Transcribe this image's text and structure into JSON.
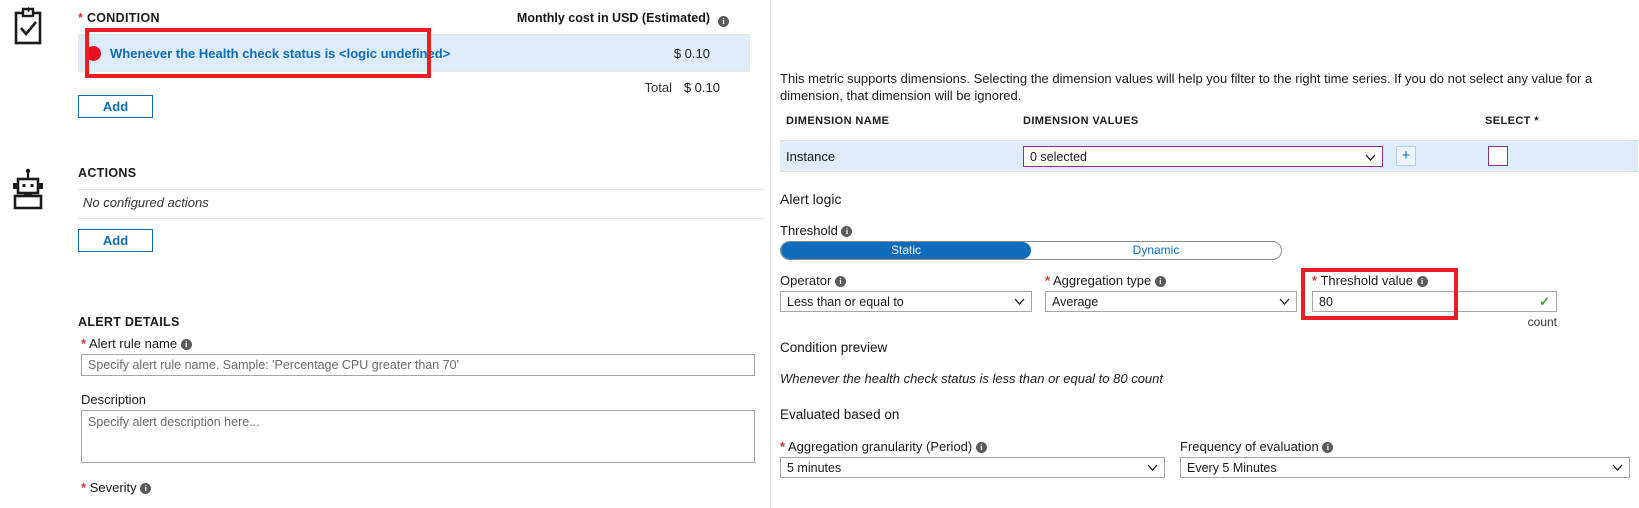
{
  "left_panel": {
    "condition": {
      "rail_icon": "clipboard-check-icon",
      "section_label": "CONDITION",
      "required_marker": "*",
      "cost_column_header": "Monthly cost in USD (Estimated)",
      "rows": [
        {
          "text": "Whenever the Health check status is <logic undefined>",
          "cost": "$ 0.10"
        }
      ],
      "total_label": "Total",
      "total_value": "$ 0.10",
      "add_label": "Add"
    },
    "actions": {
      "rail_icon": "robot-icon",
      "section_label": "ACTIONS",
      "empty_text": "No configured actions",
      "add_label": "Add"
    },
    "alert_details": {
      "section_label": "ALERT DETAILS",
      "alert_rule_name_label": "Alert rule name",
      "alert_rule_name_value": "",
      "alert_rule_name_placeholder": "Specify alert rule name. Sample: 'Percentage CPU greater than 70'",
      "description_label": "Description",
      "description_value": "",
      "description_placeholder": "Specify alert description here...",
      "severity_label": "Severity"
    }
  },
  "right_panel": {
    "dimensions": {
      "description": "This metric supports dimensions. Selecting the dimension values will help you filter to the right time series. If you do not select any value for a dimension, that dimension will be ignored.",
      "columns": [
        "DIMENSION NAME",
        "DIMENSION VALUES",
        "SELECT *"
      ],
      "rows": [
        {
          "name": "Instance",
          "values_selected": "0 selected",
          "add_label": "+"
        }
      ]
    },
    "alert_logic": {
      "title": "Alert logic",
      "threshold_label": "Threshold",
      "threshold_options": [
        "Static",
        "Dynamic"
      ],
      "threshold_selected": "Static",
      "operator_label": "Operator",
      "operator_value": "Less than or equal to",
      "aggregation_type_label": "Aggregation type",
      "aggregation_type_value": "Average",
      "threshold_value_label": "Threshold value",
      "threshold_value": "80",
      "unit_label": "count"
    },
    "condition_preview": {
      "title": "Condition preview",
      "text": "Whenever the health check status is less than or equal to 80 count"
    },
    "evaluated": {
      "title": "Evaluated based on",
      "granularity_label": "Aggregation granularity (Period)",
      "granularity_value": "5 minutes",
      "frequency_label": "Frequency of evaluation",
      "frequency_value": "Every 5 Minutes"
    }
  },
  "annotations": {
    "highlight_color": "#ec1c24",
    "boxes": [
      "condition-row-highlight",
      "threshold-value-highlight"
    ]
  },
  "icons": {
    "info": "i",
    "chevron_down": "⌄",
    "check": "✓"
  }
}
